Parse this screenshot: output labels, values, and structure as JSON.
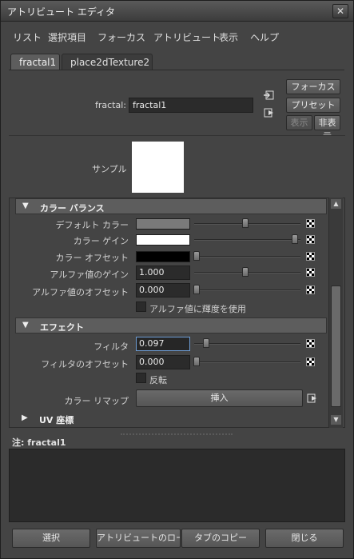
{
  "window": {
    "title": "アトリビュート エディタ",
    "close_icon": "close-icon"
  },
  "menu": [
    "リスト",
    "選択項目",
    "フォーカス",
    "アトリビュート",
    "表示",
    "ヘルプ"
  ],
  "tabs": [
    {
      "label": "fractal1",
      "active": true
    },
    {
      "label": "place2dTexture2",
      "active": false
    }
  ],
  "header": {
    "node_label": "fractal:",
    "node_value": "fractal1",
    "focus_button": "フォーカス",
    "preset_button": "プリセット",
    "show_button": "表示",
    "hide_button": "非表示"
  },
  "sample": {
    "label": "サンプル"
  },
  "sections": {
    "color_balance": {
      "title": "カラー バランス",
      "rows": [
        {
          "label": "デフォルト カラー",
          "kind": "color",
          "color": "#7a7a7a",
          "slider": 0.5
        },
        {
          "label": "カラー ゲイン",
          "kind": "color",
          "color": "#ffffff",
          "slider": 0.97
        },
        {
          "label": "カラー オフセット",
          "kind": "color",
          "color": "#000000",
          "slider": 0.0
        },
        {
          "label": "アルファ値のゲイン",
          "kind": "number",
          "value": "1.000",
          "slider": 0.5
        },
        {
          "label": "アルファ値のオフセット",
          "kind": "number",
          "value": "0.000",
          "slider": 0.0
        }
      ],
      "checkbox_label": "アルファ値に輝度を使用"
    },
    "effects": {
      "title": "エフェクト",
      "rows": [
        {
          "label": "フィルタ",
          "kind": "number",
          "value": "0.097",
          "slider": 0.097
        },
        {
          "label": "フィルタのオフセット",
          "kind": "number",
          "value": "0.000",
          "slider": 0.0
        }
      ],
      "checkbox_label": "反転",
      "remap_label": "カラー リマップ",
      "insert_button": "挿入"
    },
    "uv": {
      "title": "UV 座標"
    }
  },
  "notes": {
    "label": "注:  fractal1"
  },
  "buttons": {
    "select": "選択",
    "load_attributes": "アトリビュートのロード",
    "copy_tab": "タブのコピー",
    "close": "閉じる"
  }
}
